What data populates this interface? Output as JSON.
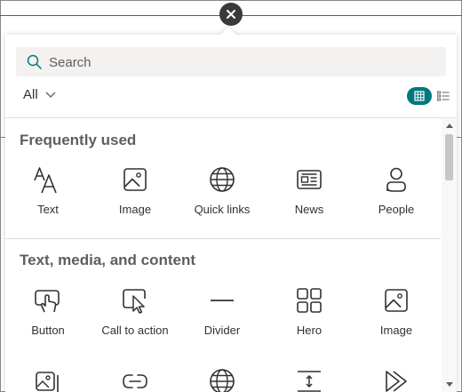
{
  "search": {
    "placeholder": "Search"
  },
  "filter": {
    "selected": "All"
  },
  "sections": [
    {
      "title": "Frequently used",
      "items": [
        {
          "label": "Text",
          "icon": "text-icon"
        },
        {
          "label": "Image",
          "icon": "image-icon"
        },
        {
          "label": "Quick links",
          "icon": "globe-icon"
        },
        {
          "label": "News",
          "icon": "news-icon"
        },
        {
          "label": "People",
          "icon": "person-icon"
        }
      ]
    },
    {
      "title": "Text, media, and content",
      "items": [
        {
          "label": "Button",
          "icon": "button-tap-icon"
        },
        {
          "label": "Call to action",
          "icon": "call-to-action-icon"
        },
        {
          "label": "Divider",
          "icon": "divider-icon"
        },
        {
          "label": "Hero",
          "icon": "hero-icon"
        },
        {
          "label": "Image",
          "icon": "image-icon"
        }
      ]
    }
  ],
  "partial_row_icons": [
    "image-gallery-icon",
    "link-icon",
    "globe-icon",
    "spacer-icon",
    "video-icon"
  ],
  "colors": {
    "accent": "#03787c",
    "close": "#3b3a39"
  }
}
